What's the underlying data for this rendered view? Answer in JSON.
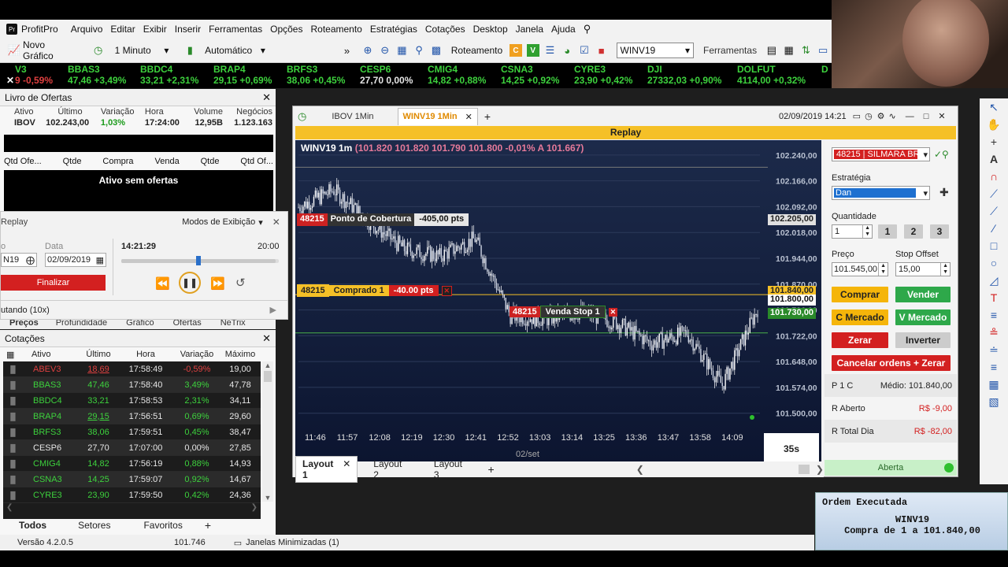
{
  "menubar": {
    "app": "ProfitPro",
    "items": [
      "Arquivo",
      "Editar",
      "Exibir",
      "Inserir",
      "Ferramentas",
      "Opções",
      "Roteamento",
      "Estratégias",
      "Cotações",
      "Desktop",
      "Janela",
      "Ajuda"
    ]
  },
  "toolbar": {
    "novo_grafico": "Novo Gráfico",
    "interval": "1 Minuto",
    "mode": "Automático",
    "roteamento": "Roteamento",
    "symbol": "WINV19",
    "ferramentas": "Ferramentas"
  },
  "ticker": [
    {
      "name": "V3",
      "val": "9 -0,59%",
      "dir": "dn"
    },
    {
      "name": "BBAS3",
      "val": "47,46 +3,49%",
      "dir": "up"
    },
    {
      "name": "BBDC4",
      "val": "33,21 +2,31%",
      "dir": "up"
    },
    {
      "name": "BRAP4",
      "val": "29,15 +0,69%",
      "dir": "up"
    },
    {
      "name": "BRFS3",
      "val": "38,06 +0,45%",
      "dir": "up"
    },
    {
      "name": "CESP6",
      "val": "27,70 0,00%",
      "dir": "flat"
    },
    {
      "name": "CMIG4",
      "val": "14,82 +0,88%",
      "dir": "up"
    },
    {
      "name": "CSNA3",
      "val": "14,25 +0,92%",
      "dir": "up"
    },
    {
      "name": "CYRE3",
      "val": "23,90 +0,42%",
      "dir": "up"
    },
    {
      "name": "DJI",
      "val": "27332,03 +0,90%",
      "dir": "up"
    },
    {
      "name": "DOLFUT",
      "val": "4114,00 +0,32%",
      "dir": "up"
    },
    {
      "name": "D",
      "val": "",
      "dir": "up"
    }
  ],
  "livro": {
    "title": "Livro de Ofertas",
    "headers": [
      "Ativo",
      "Último",
      "Variação",
      "Hora",
      "Volume",
      "Negócios"
    ],
    "row": [
      "IBOV",
      "102.243,00",
      "1,03%",
      "17:24:00",
      "12,95B",
      "1.123.163"
    ],
    "book_headers": [
      "Qtd Ofe...",
      "Qtde",
      "Compra",
      "Venda",
      "Qtde",
      "Qtd Of..."
    ],
    "empty": "Ativo sem ofertas"
  },
  "replay": {
    "title": "Replay",
    "modes": "Modos de Exibição",
    "ativo_label": "o",
    "data_label": "Data",
    "ativo": "N19",
    "data": "02/09/2019",
    "time": "14:21:29",
    "end_time": "20:00",
    "finalizar": "Finalizar",
    "status": "utando (10x)",
    "progress": 0.98
  },
  "tabs_mid": [
    "Preços",
    "Profundidade",
    "Gráfico",
    "Ofertas",
    "NeTrix"
  ],
  "cotacoes": {
    "title": "Cotações",
    "headers": [
      "Ativo",
      "Último",
      "Hora",
      "Variação",
      "Máximo"
    ],
    "rows": [
      {
        "a": "ABEV3",
        "u": "18,69",
        "h": "17:58:49",
        "v": "-0,59%",
        "m": "19,00",
        "c": "#e04040"
      },
      {
        "a": "BBAS3",
        "u": "47,46",
        "h": "17:58:40",
        "v": "3,49%",
        "m": "47,78",
        "c": "#3dd13d"
      },
      {
        "a": "BBDC4",
        "u": "33,21",
        "h": "17:58:53",
        "v": "2,31%",
        "m": "34,11",
        "c": "#3dd13d"
      },
      {
        "a": "BRAP4",
        "u": "29,15",
        "h": "17:56:51",
        "v": "0,69%",
        "m": "29,60",
        "c": "#3dd13d"
      },
      {
        "a": "BRFS3",
        "u": "38,06",
        "h": "17:59:51",
        "v": "0,45%",
        "m": "38,47",
        "c": "#3dd13d"
      },
      {
        "a": "CESP6",
        "u": "27,70",
        "h": "17:07:00",
        "v": "0,00%",
        "m": "27,85",
        "c": "#e6e6e6"
      },
      {
        "a": "CMIG4",
        "u": "14,82",
        "h": "17:56:19",
        "v": "0,88%",
        "m": "14,93",
        "c": "#3dd13d"
      },
      {
        "a": "CSNA3",
        "u": "14,25",
        "h": "17:59:07",
        "v": "0,92%",
        "m": "14,67",
        "c": "#3dd13d"
      },
      {
        "a": "CYRE3",
        "u": "23,90",
        "h": "17:59:50",
        "v": "0,42%",
        "m": "24,36",
        "c": "#3dd13d"
      }
    ],
    "tabs": [
      "Todos",
      "Setores",
      "Favoritos"
    ]
  },
  "status": {
    "version": "Versão 4.2.0.5",
    "value": "101.746",
    "minimized": "Janelas Minimizadas (1)"
  },
  "chartwin": {
    "tab1": "IBOV 1Min",
    "tab2": "WINV19 1Min",
    "datetime": "02/09/2019 14:21",
    "replay": "Replay",
    "header_sym": "WINV19 1m",
    "header_vals": "(101.820  101.820  101.790  101.800  -0,01%  A 101.667)",
    "cobertura_id": "48215",
    "cobertura_label": "Ponto de Cobertura",
    "cobertura_pts": "-405,00 pts",
    "comprado_label": "Comprado 1",
    "comprado_pts": "-40.00 pts",
    "venda_label": "Venda Stop 1",
    "price_top": "102.205,00",
    "price_buy": "101.840,00",
    "price_cur": "101.800,00",
    "price_stop": "101.730,00",
    "yticks": [
      "102.240,00",
      "102.166,00",
      "102.092,00",
      "102.018,00",
      "101.944,00",
      "101.870,00",
      "101.796,00",
      "101.722,00",
      "101.648,00",
      "101.574,00",
      "101.500,00"
    ],
    "xticks": [
      "11:46",
      "11:57",
      "12:08",
      "12:19",
      "12:30",
      "12:41",
      "12:52",
      "13:03",
      "13:14",
      "13:25",
      "13:36",
      "13:47",
      "13:58",
      "14:09"
    ],
    "date_label": "02/set",
    "countdown": "35s",
    "layouts": [
      "Layout 1",
      "Layout 2",
      "Layout 3"
    ]
  },
  "chart_data": {
    "type": "candlestick",
    "ylim": [
      101470,
      102260
    ],
    "x": [
      "11:46",
      "11:57",
      "12:08",
      "12:19",
      "12:30",
      "12:41",
      "12:52",
      "13:03",
      "13:14",
      "13:25",
      "13:36",
      "13:47",
      "13:58",
      "14:09"
    ],
    "close": [
      102090,
      102140,
      102050,
      101970,
      101950,
      102000,
      101780,
      101770,
      101790,
      101760,
      101700,
      101730,
      101580,
      101800
    ]
  },
  "side": {
    "account": "48215 | SILMARA BR",
    "estrategia_label": "Estratégia",
    "estrategia": "Dan",
    "qtd_label": "Quantidade",
    "qtd": "1",
    "q1": "1",
    "q2": "2",
    "q3": "3",
    "preco_label": "Preço",
    "preco": "101.545,00",
    "stop_label": "Stop Offset",
    "stop": "15,00",
    "comprar": "Comprar",
    "vender": "Vender",
    "cmercado": "C Mercado",
    "vmercado": "V Mercado",
    "zerar": "Zerar",
    "inverter": "Inverter",
    "cancelar": "Cancelar ordens + Zerar",
    "pos": "P  1 C",
    "medio": "Médio: 101.840,00",
    "raberto_label": "R Aberto",
    "raberto": "R$ -9,00",
    "rtotal_label": "R Total Dia",
    "rtotal": "R$ -82,00",
    "aberta": "Aberta"
  },
  "notif": {
    "title": "Ordem Executada",
    "line1": "WINV19",
    "line2": "Compra de 1 a 101.840,00"
  }
}
